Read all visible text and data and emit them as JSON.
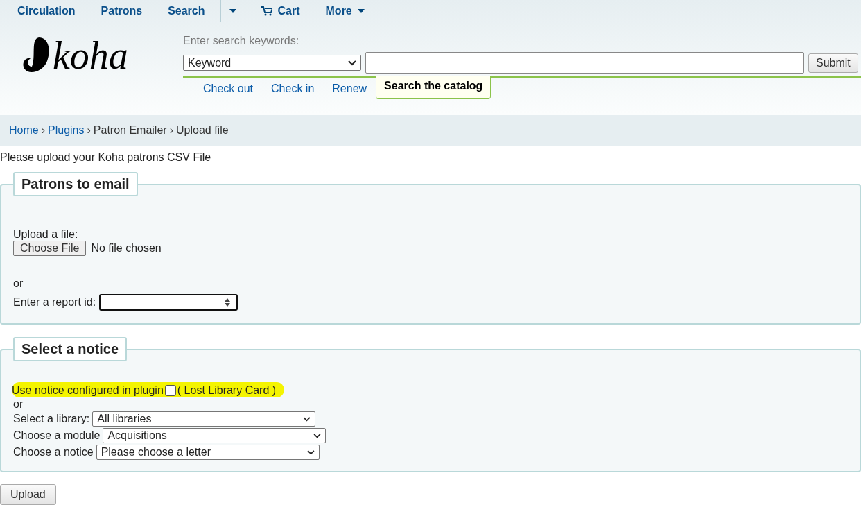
{
  "nav": [
    {
      "kind": "link",
      "label": "Circulation"
    },
    {
      "kind": "link",
      "label": "Patrons"
    },
    {
      "kind": "link",
      "label": "Search"
    },
    {
      "kind": "dropdown"
    },
    {
      "kind": "cart",
      "label": "Cart"
    },
    {
      "kind": "menu",
      "label": "More"
    }
  ],
  "logo": {
    "text": "koha"
  },
  "search": {
    "label": "Enter search keywords:",
    "type": "Keyword",
    "button": "Submit",
    "tabs": [
      {
        "label": "Check out",
        "selected": false
      },
      {
        "label": "Check in",
        "selected": false
      },
      {
        "label": "Renew",
        "selected": false
      },
      {
        "label": "Search the catalog",
        "selected": true
      }
    ]
  },
  "breadcrumbs": [
    {
      "label": "Home",
      "link": true
    },
    {
      "separator": "›",
      "label": "Plugins",
      "link": true
    },
    {
      "separator": "›",
      "label": "Patron Emailer",
      "link": false
    },
    {
      "separator": "›",
      "label": "Upload file",
      "link": false
    }
  ],
  "intro": "Please upload your Koha patrons CSV File",
  "patrons_fieldset": {
    "legend": "Patrons to email",
    "upload_label": "Upload a file:",
    "file_button": "Choose File",
    "file_status": "No file chosen",
    "or": "or",
    "report_label": "Enter a report id:"
  },
  "notice_fieldset": {
    "legend": "Select a notice",
    "plugin_notice": {
      "label": "Use notice configured in plugin",
      "checked": false,
      "notice": "( Lost Library Card )",
      "highlighted": true
    },
    "or": "or",
    "selects": [
      {
        "label": "Select a library:",
        "value": "All libraries"
      },
      {
        "label": "Choose a module",
        "value": "Acquisitions"
      },
      {
        "label": "Choose a notice",
        "value": "Please choose a letter"
      }
    ]
  },
  "upload_button": "Upload"
}
